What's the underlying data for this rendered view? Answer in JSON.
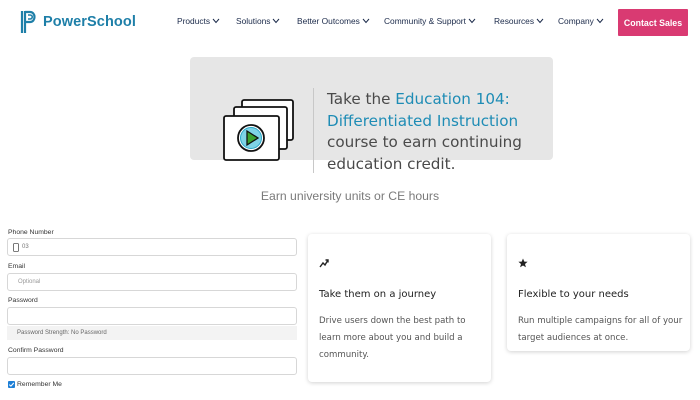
{
  "brand": {
    "name": "PowerSchool",
    "color": "#1e7fa8"
  },
  "nav": {
    "items": [
      {
        "label": "Products"
      },
      {
        "label": "Solutions"
      },
      {
        "label": "Better Outcomes"
      },
      {
        "label": "Community & Support"
      },
      {
        "label": "Resources"
      },
      {
        "label": "Company"
      }
    ],
    "cta_label": "Contact Sales",
    "cta_color": "#d93a72"
  },
  "hero": {
    "line_before": "Take the ",
    "highlight": "Education 104: Differentiated Instruction",
    "line_after": " course to earn continuing education credit.",
    "highlight_color": "#1e8cb5",
    "icon": "video-stack-play-icon"
  },
  "subtitle": "Earn university units or CE hours",
  "form": {
    "phone": {
      "label": "Phone Number",
      "value": "03",
      "icon": "phone-icon"
    },
    "email": {
      "label": "Email",
      "placeholder": "Optional"
    },
    "password": {
      "label": "Password",
      "value": "",
      "strength": "Password Strength: No Password"
    },
    "confirm_password": {
      "label": "Confirm Password",
      "value": ""
    },
    "remember_me": {
      "label": "Remember Me",
      "checked": true
    }
  },
  "cards": [
    {
      "icon": "trending-arrow-icon",
      "title": "Take them on a journey",
      "desc": "Drive users down the best path to learn more about you and build a community."
    },
    {
      "icon": "star-icon",
      "title": "Flexible to your needs",
      "desc": "Run multiple campaigns for all of your target audiences at once."
    }
  ]
}
